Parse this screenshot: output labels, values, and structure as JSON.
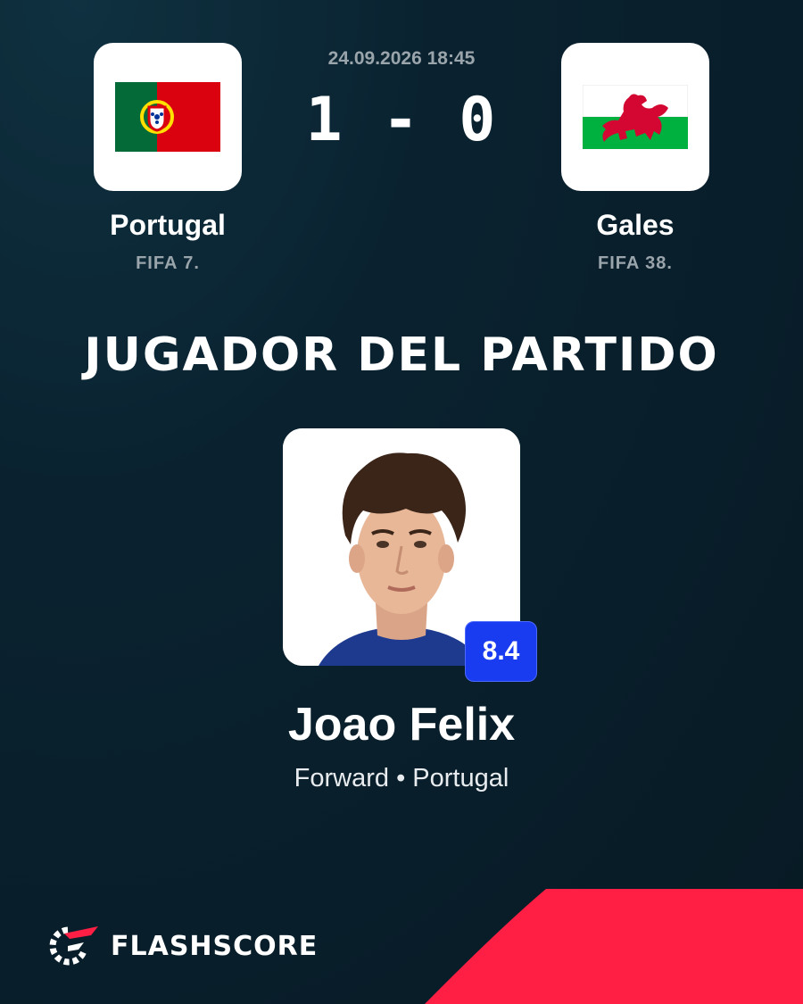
{
  "match": {
    "datetime": "24.09.2026 18:45",
    "score": "1 - 0",
    "home": {
      "name": "Portugal",
      "rank": "FIFA 7.",
      "flag": "portugal-flag-icon"
    },
    "away": {
      "name": "Gales",
      "rank": "FIFA 38.",
      "flag": "wales-flag-icon"
    }
  },
  "motm": {
    "title": "JUGADOR DEL PARTIDO",
    "player_name": "Joao Felix",
    "player_info": "Forward • Portugal",
    "rating": "8.4"
  },
  "brand": {
    "name": "FLASHSCORE"
  },
  "colors": {
    "background": "#071a24",
    "accent_red": "#ff1f44",
    "rating_blue": "#1a3cf0",
    "muted_text": "#9aa4ab"
  }
}
